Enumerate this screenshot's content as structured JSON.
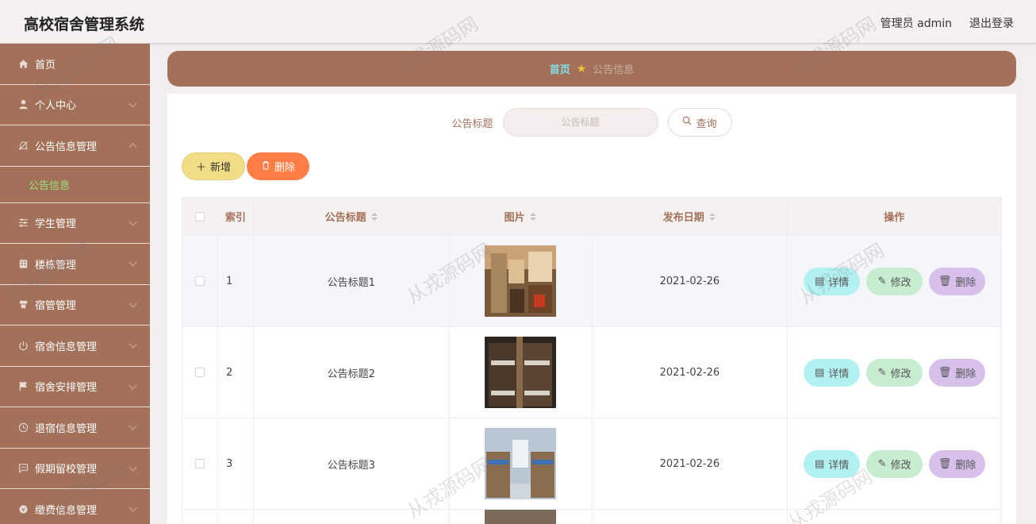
{
  "app": {
    "title": "高校宿舍管理系统"
  },
  "header": {
    "user_label": "管理员 admin",
    "logout_label": "退出登录"
  },
  "sidebar": {
    "items": [
      {
        "label": "首页",
        "icon": "home-icon"
      },
      {
        "label": "个人中心",
        "icon": "user-icon"
      },
      {
        "label": "公告信息管理",
        "icon": "bell-off-icon",
        "expanded": true,
        "children": [
          {
            "label": "公告信息"
          }
        ]
      },
      {
        "label": "学生管理",
        "icon": "sliders-icon"
      },
      {
        "label": "楼栋管理",
        "icon": "building-icon"
      },
      {
        "label": "宿管管理",
        "icon": "manager-icon"
      },
      {
        "label": "宿舍信息管理",
        "icon": "power-icon"
      },
      {
        "label": "宿舍安排管理",
        "icon": "flag-icon"
      },
      {
        "label": "退宿信息管理",
        "icon": "clock-icon"
      },
      {
        "label": "假期留校管理",
        "icon": "message-icon"
      },
      {
        "label": "缴费信息管理",
        "icon": "money-icon"
      }
    ]
  },
  "breadcrumb": {
    "home": "首页",
    "current": "公告信息"
  },
  "search": {
    "label": "公告标题",
    "placeholder": "公告标题",
    "button_label": "查询"
  },
  "toolbar": {
    "add_label": "新增",
    "delete_label": "删除"
  },
  "table": {
    "columns": [
      "索引",
      "公告标题",
      "图片",
      "发布日期",
      "操作"
    ],
    "rows": [
      {
        "index": "1",
        "title": "公告标题1",
        "date": "2021-02-26"
      },
      {
        "index": "2",
        "title": "公告标题2",
        "date": "2021-02-26"
      },
      {
        "index": "3",
        "title": "公告标题3",
        "date": "2021-02-26"
      }
    ],
    "actions": {
      "detail": "详情",
      "edit": "修改",
      "delete": "删除"
    }
  },
  "watermark": "从戎源码网",
  "colors": {
    "brand": "#a3705a",
    "accent_link": "#9be27a",
    "delete": "#ff7d46",
    "add": "#f2dc87"
  }
}
